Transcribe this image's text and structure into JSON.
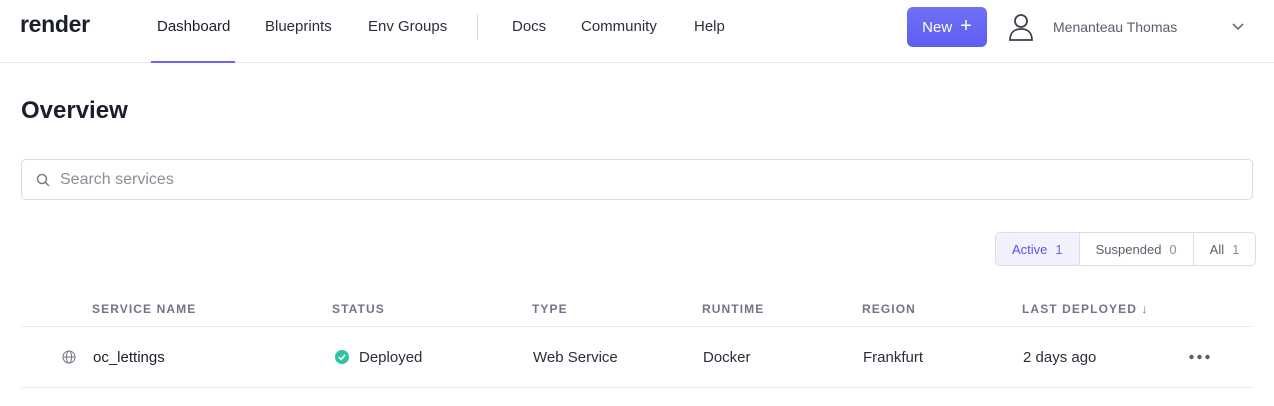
{
  "brand": {
    "logo_text": "render"
  },
  "nav": {
    "items": [
      {
        "label": "Dashboard"
      },
      {
        "label": "Blueprints"
      },
      {
        "label": "Env Groups"
      },
      {
        "label": "Docs"
      },
      {
        "label": "Community"
      },
      {
        "label": "Help"
      }
    ],
    "active": "Dashboard"
  },
  "header": {
    "new_button_label": "New",
    "new_button_icon": "plus-icon",
    "user_name": "Menanteau Thomas",
    "avatar_icon": "user-icon",
    "menu_icon": "chevron-down-icon"
  },
  "main": {
    "title": "Overview",
    "search": {
      "placeholder": "Search services",
      "value": ""
    },
    "filters": [
      {
        "label": "Active",
        "count": "1",
        "selected": true
      },
      {
        "label": "Suspended",
        "count": "0",
        "selected": false
      },
      {
        "label": "All",
        "count": "1",
        "selected": false
      }
    ]
  },
  "table": {
    "columns": [
      "SERVICE NAME",
      "STATUS",
      "TYPE",
      "RUNTIME",
      "REGION",
      "LAST DEPLOYED ↓"
    ],
    "rows": [
      {
        "icon": "globe-icon",
        "name": "oc_lettings",
        "status": "Deployed",
        "status_icon": "check-circle-icon",
        "type": "Web Service",
        "runtime": "Docker",
        "region": "Frankfurt",
        "last_deployed": "2 days ago",
        "actions_icon": "more-horizontal-icon"
      }
    ]
  },
  "colors": {
    "accent": "#6c63f0",
    "button_bg": "#6567f3",
    "status_ok": "#2ec4a0",
    "filter_active_bg": "#f1f0fd"
  }
}
